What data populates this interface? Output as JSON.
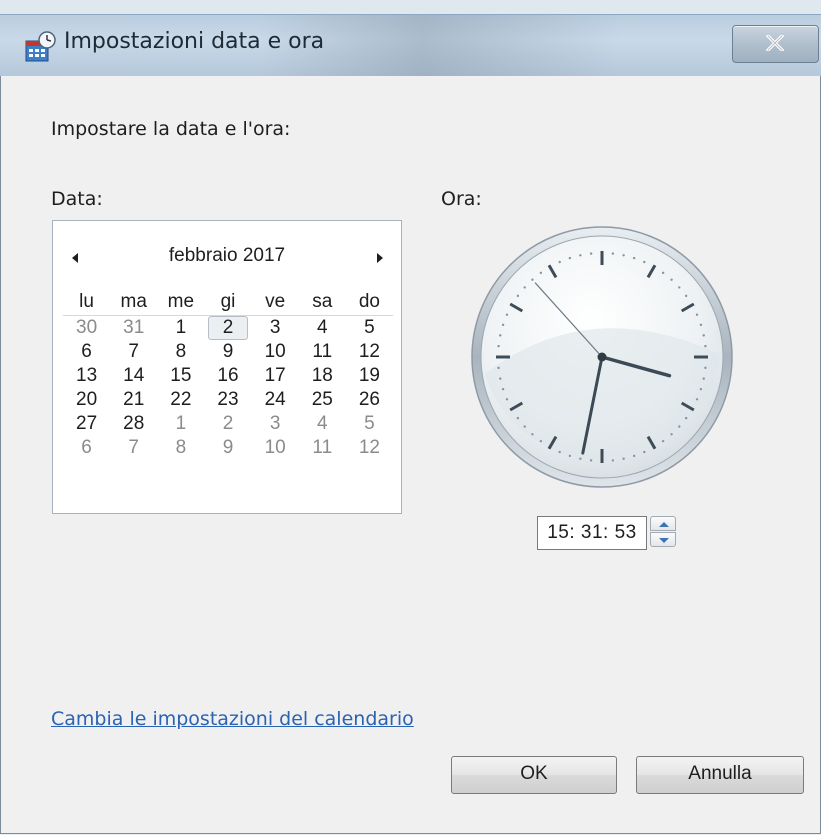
{
  "window": {
    "title": "Impostazioni data e ora",
    "close_glyph": "X"
  },
  "heading": "Impostare la data e l'ora:",
  "date_label": "Data:",
  "time_label": "Ora:",
  "calendar": {
    "month_year": "febbraio 2017",
    "prev_icon": "triangle-left-icon",
    "next_icon": "triangle-right-icon",
    "weekdays": [
      "lu",
      "ma",
      "me",
      "gi",
      "ve",
      "sa",
      "do"
    ],
    "weeks": [
      [
        {
          "d": "30",
          "m": true
        },
        {
          "d": "31",
          "m": true
        },
        {
          "d": "1"
        },
        {
          "d": "2",
          "t": true
        },
        {
          "d": "3"
        },
        {
          "d": "4"
        },
        {
          "d": "5"
        }
      ],
      [
        {
          "d": "6"
        },
        {
          "d": "7"
        },
        {
          "d": "8"
        },
        {
          "d": "9"
        },
        {
          "d": "10"
        },
        {
          "d": "11"
        },
        {
          "d": "12"
        }
      ],
      [
        {
          "d": "13"
        },
        {
          "d": "14"
        },
        {
          "d": "15"
        },
        {
          "d": "16"
        },
        {
          "d": "17"
        },
        {
          "d": "18"
        },
        {
          "d": "19"
        }
      ],
      [
        {
          "d": "20"
        },
        {
          "d": "21"
        },
        {
          "d": "22"
        },
        {
          "d": "23"
        },
        {
          "d": "24"
        },
        {
          "d": "25"
        },
        {
          "d": "26"
        }
      ],
      [
        {
          "d": "27"
        },
        {
          "d": "28"
        },
        {
          "d": "1",
          "m": true
        },
        {
          "d": "2",
          "m": true
        },
        {
          "d": "3",
          "m": true
        },
        {
          "d": "4",
          "m": true
        },
        {
          "d": "5",
          "m": true
        }
      ],
      [
        {
          "d": "6",
          "m": true
        },
        {
          "d": "7",
          "m": true
        },
        {
          "d": "8",
          "m": true
        },
        {
          "d": "9",
          "m": true
        },
        {
          "d": "10",
          "m": true
        },
        {
          "d": "11",
          "m": true
        },
        {
          "d": "12",
          "m": true
        }
      ]
    ]
  },
  "clock": {
    "hours": 15,
    "minutes": 31,
    "seconds": 53
  },
  "time_value": "15: 31: 53",
  "link_text": "Cambia le impostazioni del calendario",
  "buttons": {
    "ok": "OK",
    "cancel": "Annulla"
  },
  "colors": {
    "link": "#2a63b3",
    "window_bg": "#f0f0f0"
  }
}
